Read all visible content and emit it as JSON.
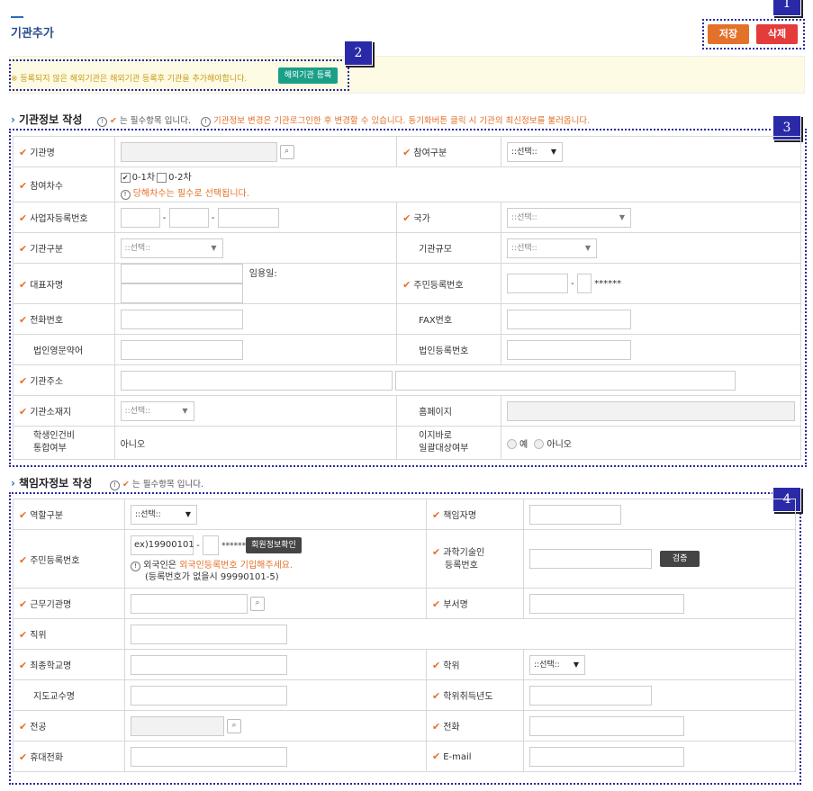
{
  "header": {
    "title": "기관추가",
    "save_label": "저장",
    "delete_label": "삭제"
  },
  "markers": [
    "1",
    "2",
    "3",
    "4"
  ],
  "notice": {
    "text": "※ 등록되지 않은 해외기관은 해외기관 등록후 기관을 추가해야합니다.",
    "button_label": "해외기관 등록"
  },
  "institution_section": {
    "title": "기관정보 작성",
    "required_hint": "는 필수항목 입니다.",
    "update_hint": "기관정보 변경은 기관로그인한 후 변경할 수 있습니다. 동기화버튼 클릭 시 기관의 최신정보를 불러옵니다.",
    "fields": {
      "name": "기관명",
      "participation": "참여구분",
      "round": "참여차수",
      "round_opt1": "0-1차",
      "round_opt2": "0-2차",
      "round_warning": "당해차수는 필수로 선택됩니다.",
      "biz_no": "사업자등록번호",
      "country": "국가",
      "inst_type": "기관구분",
      "inst_size": "기관규모",
      "ceo": "대표자명",
      "appointed": "임용일:",
      "resident_no": "주민등록번호",
      "resident_mask": "******",
      "phone": "전화번호",
      "fax": "FAX번호",
      "corp_eng": "법인영문약어",
      "corp_no": "법인등록번호",
      "address": "기관주소",
      "location": "기관소재지",
      "homepage": "홈페이지",
      "student_label1": "학생인건비",
      "student_label2": "통합여부",
      "student_value": "아니오",
      "ezbaro_label1": "이지바로",
      "ezbaro_label2": "일괄대상여부",
      "yes": "예",
      "no": "아니오"
    },
    "select_placeholder": "::선택::"
  },
  "manager_section": {
    "title": "책임자정보 작성",
    "required_hint": "는 필수항목 입니다.",
    "fields": {
      "role": "역할구분",
      "manager_name": "책임자명",
      "resident_no": "주민등록번호",
      "resident_example": "ex)19900101",
      "resident_mask": "******",
      "member_check": "회원정보확인",
      "foreign_prefix": "외국인은",
      "foreign_highlight": "외국인등록번호 기입해주세요.",
      "foreign_note": "(등록번호가 없을시 99990101-5)",
      "sci_label1": "과학기술인",
      "sci_label2": "등록번호",
      "verify": "검증",
      "workplace": "근무기관명",
      "department": "부서명",
      "position": "직위",
      "school": "최종학교명",
      "degree": "학위",
      "advisor": "지도교수명",
      "degree_year": "학위취득년도",
      "major": "전공",
      "phone": "전화",
      "mobile": "휴대전화",
      "email": "E-mail"
    },
    "select_placeholder": "::선택::"
  }
}
